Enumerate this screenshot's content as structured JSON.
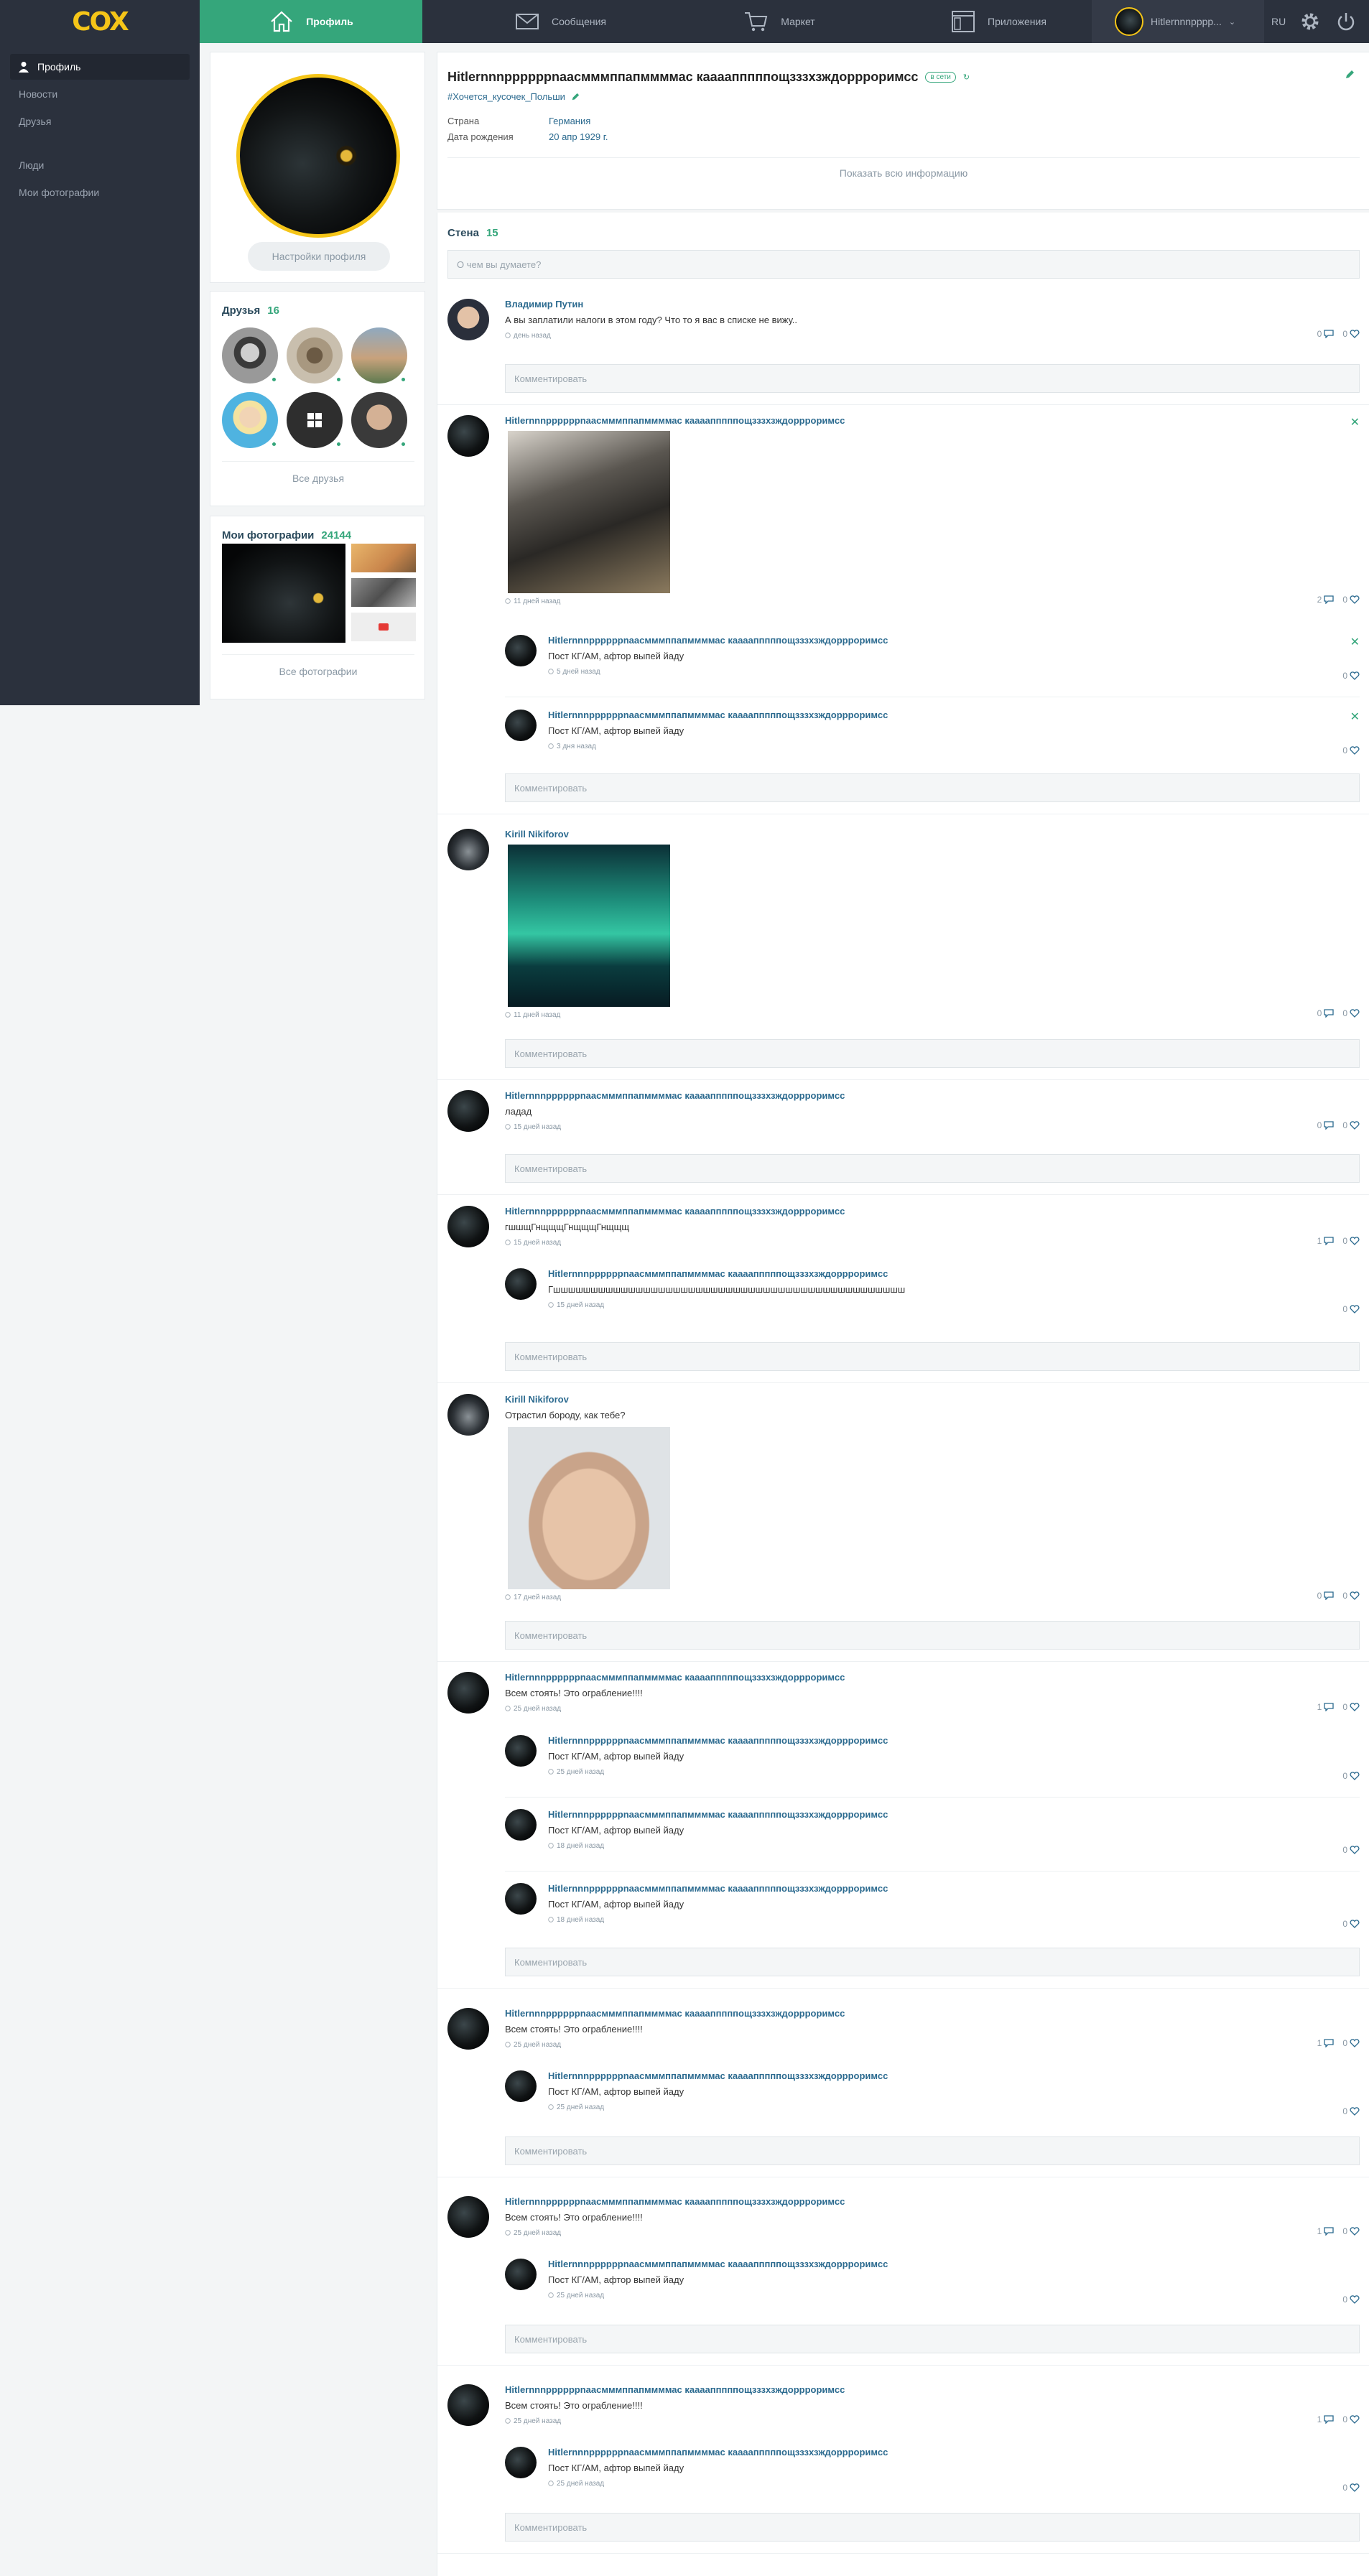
{
  "topbar": {
    "logo": "COX",
    "tabs": [
      {
        "label": "Профиль",
        "icon": "home-icon"
      },
      {
        "label": "Сообщения",
        "icon": "envelope-icon"
      },
      {
        "label": "Маркет",
        "icon": "cart-icon"
      },
      {
        "label": "Приложения",
        "icon": "window-icon"
      }
    ],
    "username": "Hitlernnnpppp...",
    "lang": "RU",
    "colors": {
      "bar": "#2b313d",
      "active_tab": "#35a67b",
      "logo": "#f5c518"
    }
  },
  "sidebar": {
    "items": [
      {
        "label": "Профиль",
        "icon": "user-icon"
      },
      {
        "label": "Новости"
      },
      {
        "label": "Друзья"
      },
      {
        "label": "Люди"
      },
      {
        "label": "Мои фотографии"
      }
    ]
  },
  "profile": {
    "settings_button": "Настройки профиля",
    "name": "Hitlernnnppppppnaacмммппапммммас каааапппппощзззхзждорррoримсс",
    "status_badge": "в сети",
    "status_text": "#Хочется_кусочек_Польши",
    "fields": [
      {
        "label": "Страна",
        "value": "Германия"
      },
      {
        "label": "Дата рождения",
        "value": "20 апр 1929 г."
      }
    ],
    "show_all": "Показать всю информацию"
  },
  "friends": {
    "title": "Друзья",
    "count": "16",
    "all_link": "Все друзья"
  },
  "photos": {
    "title": "Мои фотографии",
    "count": "24144",
    "all_link": "Все фотографии"
  },
  "wall": {
    "title": "Стена",
    "count": "15",
    "placeholder": "О чем вы думаете?",
    "comment_placeholder": "Комментировать",
    "posts": [
      {
        "author": "Владимир Путин",
        "text": "А вы заплатили налоги в этом году? Что то я вас в списке не вижу..",
        "time": "день назад",
        "comments": "0",
        "likes": "0"
      },
      {
        "author": "Hitlernnnppppppnaacмммппапммммас каааапппппощзззхзждорррoримсс",
        "text": "",
        "time": "11 дней назад",
        "comments": "2",
        "likes": "0",
        "replies": [
          {
            "author": "Hitlernnnppppppnaacмммппапммммас каааапппппощзззхзждорррoримсс",
            "text": "Пост КГ/АМ, афтор выпей йаду",
            "time": "5 дней назад",
            "likes": "0"
          },
          {
            "author": "Hitlernnnppppppnaacмммппапммммас каааапппппощзззхзждорррoримсс",
            "text": "Пост КГ/АМ, афтор выпей йаду",
            "time": "3 дня назад",
            "likes": "0"
          }
        ]
      },
      {
        "author": "Kirill Nikiforov",
        "text": "",
        "time": "11 дней назад",
        "comments": "0",
        "likes": "0"
      },
      {
        "author": "Hitlernnnppppppnaacмммппапммммас каааапппппощзззхзждорррoримсс",
        "text": "ладад",
        "time": "15 дней назад",
        "comments": "0",
        "likes": "0"
      },
      {
        "author": "Hitlernnnppppppnaacмммппапммммас каааапппппощзззхзждорррoримсс",
        "text": "гшшщГнщщщГнщщщГнщщщ",
        "time": "15 дней назад",
        "comments": "1",
        "likes": "0",
        "replies": [
          {
            "author": "Hitlernnnppppppnaacмммппапммммас каааапппппощзззхзждорррoримсс",
            "text": "Гшшшшшшшшшшшшшшшшшшшшшшшшшшшшшшшшшшшшшшшшшшшшшшш",
            "time": "15 дней назад",
            "likes": "0"
          }
        ]
      },
      {
        "author": "Kirill Nikiforov",
        "text": "Отрастил бороду, как тебе?",
        "time": "17 дней назад",
        "comments": "0",
        "likes": "0"
      },
      {
        "author": "Hitlernnnppppppnaacмммппапммммас каааапппппощзззхзждорррoримсс",
        "text": "Всем стоять! Это ограбление!!!!",
        "time": "25 дней назад",
        "comments": "1",
        "likes": "0",
        "replies": [
          {
            "author": "Hitlernnnppppppnaacмммппапммммас каааапппппощзззхзждорррoримсс",
            "text": "Пост КГ/АМ, афтор выпей йаду",
            "time": "25 дней назад",
            "likes": "0"
          },
          {
            "author": "Hitlernnnppppppnaacмммппапммммас каааапппппощзззхзждорррoримсс",
            "text": "Пост КГ/АМ, афтор выпей йаду",
            "time": "18 дней назад",
            "likes": "0"
          },
          {
            "author": "Hitlernnnppppppnaacмммппапммммас каааапппппощзззхзждорррoримсс",
            "text": "Пост КГ/АМ, афтор выпей йаду",
            "time": "18 дней назад",
            "likes": "0"
          }
        ]
      },
      {
        "author": "Hitlernnnppppppnaacмммппапммммас каааапппппощзззхзждорррoримсс",
        "text": "Всем стоять! Это ограбление!!!!",
        "time": "25 дней назад",
        "comments": "1",
        "likes": "0",
        "replies": [
          {
            "author": "Hitlernnnppppppnaacмммппапммммас каааапппппощзззхзждорррoримсс",
            "text": "Пост КГ/АМ, афтор выпей йаду",
            "time": "25 дней назад",
            "likes": "0"
          }
        ]
      },
      {
        "author": "Hitlernnnppppppnaacмммппапммммас каааапппппощзззхзждорррoримсс",
        "text": "Всем стоять! Это ограбление!!!!",
        "time": "25 дней назад",
        "comments": "1",
        "likes": "0",
        "replies": [
          {
            "author": "Hitlernnnppppppnaacмммппапммммас каааапппппощзззхзждорррoримсс",
            "text": "Пост КГ/АМ, афтор выпей йаду",
            "time": "25 дней назад",
            "likes": "0"
          }
        ]
      },
      {
        "author": "Hitlernnnppppppnaacмммппапммммас каааапппппощзззхзждорррoримсс",
        "text": "Всем стоять! Это ограбление!!!!",
        "time": "25 дней назад",
        "comments": "1",
        "likes": "0",
        "replies": [
          {
            "author": "Hitlernnnppppppnaacмммппапммммас каааапппппощзззхзждорррoримсс",
            "text": "Пост КГ/АМ, афтор выпей йаду",
            "time": "25 дней назад",
            "likes": "0"
          }
        ]
      }
    ]
  }
}
